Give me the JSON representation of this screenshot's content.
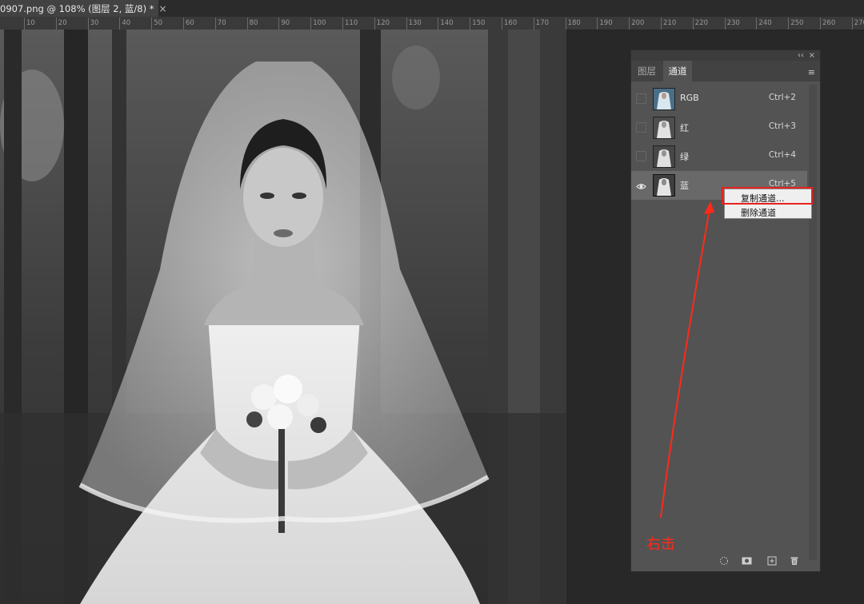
{
  "document_tab": {
    "title": "0907.png @ 108% (图层 2, 蓝/8) *",
    "close_glyph": "×"
  },
  "ruler": {
    "labels": [
      "10",
      "20",
      "30",
      "40",
      "50",
      "60",
      "70",
      "80",
      "90",
      "100",
      "110",
      "120",
      "130",
      "140",
      "150",
      "160",
      "170",
      "180",
      "190",
      "200",
      "210",
      "220",
      "230",
      "240",
      "250",
      "260",
      "270"
    ]
  },
  "channels_panel": {
    "collapse_glyph": "‹‹",
    "close_glyph": "×",
    "tabs": [
      {
        "label": "图层",
        "active": false
      },
      {
        "label": "通道",
        "active": true
      }
    ],
    "menu_glyph": "≡",
    "channels": [
      {
        "name": "RGB",
        "shortcut": "Ctrl+2",
        "visible": false,
        "selected": false
      },
      {
        "name": "红",
        "shortcut": "Ctrl+3",
        "visible": false,
        "selected": false
      },
      {
        "name": "绿",
        "shortcut": "Ctrl+4",
        "visible": false,
        "selected": false
      },
      {
        "name": "蓝",
        "shortcut": "Ctrl+5",
        "visible": true,
        "selected": true
      }
    ],
    "footer_icons": [
      "load-selection-icon",
      "save-selection-icon",
      "new-channel-icon",
      "trash-icon"
    ]
  },
  "context_menu": {
    "items": [
      "复制通道...",
      "删除通道"
    ],
    "highlighted_index": 0,
    "highlight_color": "#e8221d"
  },
  "annotation": {
    "text": "右击",
    "color": "#ff2a1a"
  }
}
